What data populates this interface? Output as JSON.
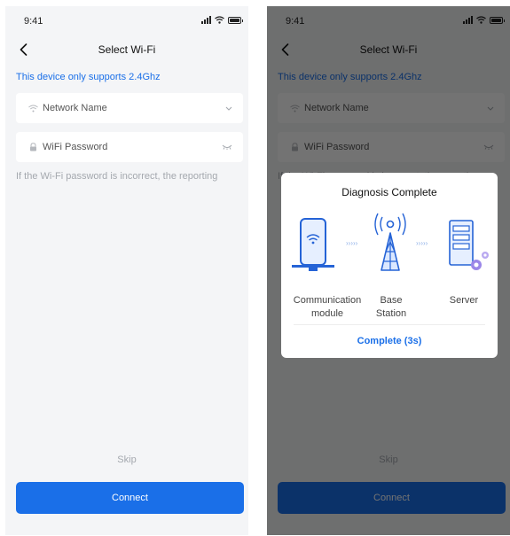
{
  "status": {
    "time": "9:41"
  },
  "nav": {
    "title": "Select Wi-Fi"
  },
  "notice": "This device only supports 2.4Ghz",
  "fields": {
    "network_placeholder": "Network Name",
    "password_placeholder": "WiFi Password"
  },
  "hint": "If the Wi-Fi password is incorrect, the reporting",
  "skip_label": "Skip",
  "connect_label": "Connect",
  "dialog": {
    "title": "Diagnosis Complete",
    "labels": {
      "module": "Communication module",
      "station": "Base Station",
      "server": "Server"
    },
    "action": "Complete (3s)"
  },
  "icons": [
    "signal-icon",
    "wifi-icon",
    "battery-icon",
    "back-arrow-icon",
    "chevron-down-icon",
    "lock-icon",
    "eye-closed-icon",
    "router-icon",
    "antenna-tower-icon",
    "server-icon",
    "gear-icon"
  ],
  "colors": {
    "accent": "#1a6fe8",
    "background": "#f4f5f7",
    "hint": "#a4a8ae"
  }
}
